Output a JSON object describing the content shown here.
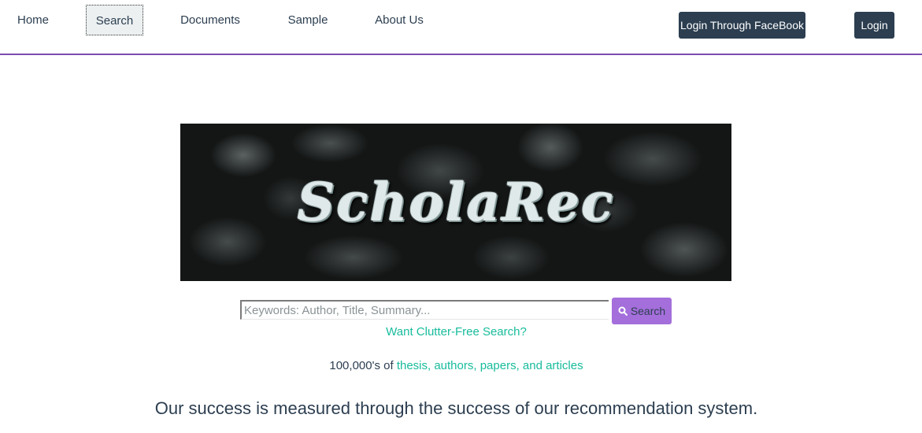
{
  "nav": {
    "items": [
      {
        "label": "Home"
      },
      {
        "label": "Search",
        "active": true
      },
      {
        "label": "Documents"
      },
      {
        "label": "Sample"
      },
      {
        "label": "About Us"
      }
    ],
    "facebook_login_label": "Login Through FaceBook",
    "login_label": "Login"
  },
  "banner": {
    "logo_text": "ScholaRec"
  },
  "search": {
    "placeholder": "Keywords: Author, Title, Summary...",
    "value": "",
    "button_label": "Search",
    "button_icon": "search-icon",
    "clutter_free_link": "Want Clutter-Free Search?"
  },
  "stats": {
    "count_text": "100,000's of ",
    "link_text": "thesis, authors, papers, and articles"
  },
  "tagline": "Our success is measured through the success of our recommendation system.",
  "colors": {
    "nav_border": "#7d4cb0",
    "dark_button": "#2c3e50",
    "search_button": "#a46edb",
    "link": "#18bc9c",
    "text": "#2c3e50"
  }
}
